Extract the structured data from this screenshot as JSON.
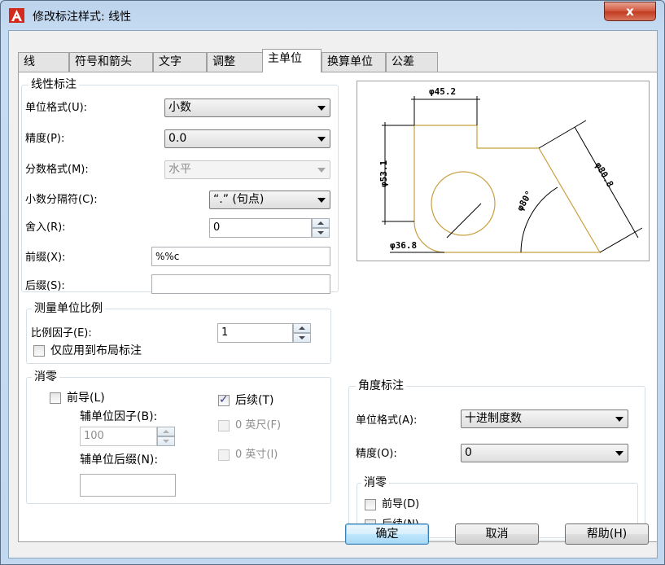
{
  "window": {
    "title": "修改标注样式: 线性",
    "close_label": "x"
  },
  "tabs": [
    "线",
    "符号和箭头",
    "文字",
    "调整",
    "主单位",
    "换算单位",
    "公差"
  ],
  "linear": {
    "legend": "线性标注",
    "unit_format_label": "单位格式(U):",
    "unit_format_value": "小数",
    "precision_label": "精度(P):",
    "precision_value": "0.0",
    "fraction_format_label": "分数格式(M):",
    "fraction_format_value": "水平",
    "decimal_sep_label": "小数分隔符(C):",
    "decimal_sep_value": "“.” (句点)",
    "round_label": "舍入(R):",
    "round_value": "0",
    "prefix_label": "前缀(X):",
    "prefix_value": "%%c",
    "suffix_label": "后缀(S):",
    "suffix_value": ""
  },
  "scale": {
    "legend": "测量单位比例",
    "factor_label": "比例因子(E):",
    "factor_value": "1",
    "layout_only_label": "仅应用到布局标注"
  },
  "zero_linear": {
    "legend": "消零",
    "leading_label": "前导(L)",
    "leading_checked": false,
    "trailing_label": "后续(T)",
    "trailing_checked": true,
    "sub_factor_label": "辅单位因子(B):",
    "sub_factor_value": "100",
    "sub_suffix_label": "辅单位后缀(N):",
    "sub_suffix_value": "",
    "feet_label": "0 英尺(F)",
    "inches_label": "0 英寸(I)"
  },
  "angular": {
    "legend": "角度标注",
    "unit_format_label": "单位格式(A):",
    "unit_format_value": "十进制度数",
    "precision_label": "精度(O):",
    "precision_value": "0"
  },
  "zero_angular": {
    "legend": "消零",
    "leading_label": "前导(D)",
    "trailing_label": "后续(N)"
  },
  "preview": {
    "dim_top": "φ45.2",
    "dim_left": "φ53.1",
    "dim_right": "φ80.8",
    "dim_angle": "φ80°",
    "dim_circle": "φ36.8"
  },
  "buttons": {
    "ok": "确定",
    "cancel": "取消",
    "help": "帮助(H)"
  },
  "colors": {
    "geometry": "#c8a040",
    "dimension": "#000000"
  }
}
